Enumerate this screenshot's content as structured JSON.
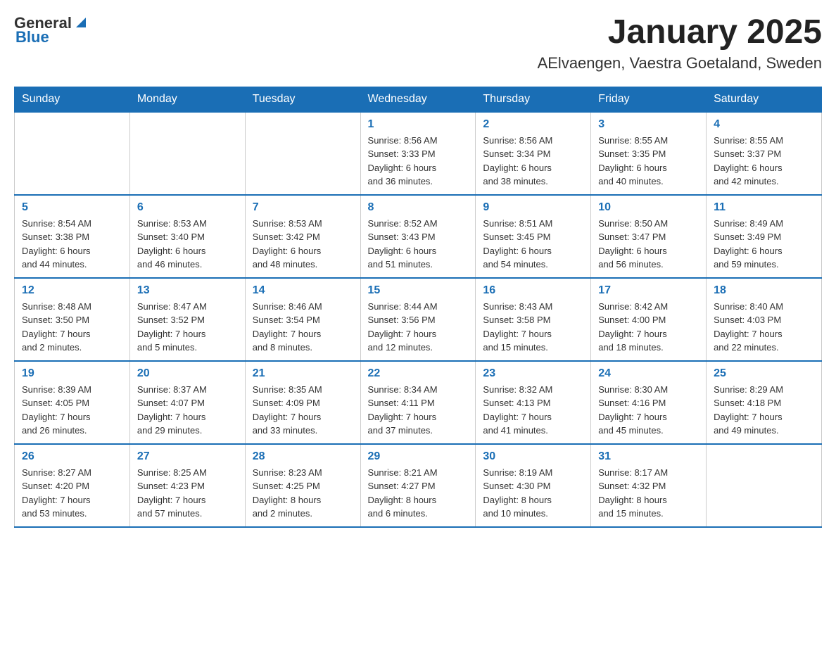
{
  "header": {
    "logo": {
      "general": "General",
      "blue": "Blue"
    },
    "title": "January 2025",
    "location": "AElvaengen, Vaestra Goetaland, Sweden"
  },
  "weekdays": [
    "Sunday",
    "Monday",
    "Tuesday",
    "Wednesday",
    "Thursday",
    "Friday",
    "Saturday"
  ],
  "weeks": [
    {
      "days": [
        {
          "number": "",
          "info": ""
        },
        {
          "number": "",
          "info": ""
        },
        {
          "number": "",
          "info": ""
        },
        {
          "number": "1",
          "info": "Sunrise: 8:56 AM\nSunset: 3:33 PM\nDaylight: 6 hours\nand 36 minutes."
        },
        {
          "number": "2",
          "info": "Sunrise: 8:56 AM\nSunset: 3:34 PM\nDaylight: 6 hours\nand 38 minutes."
        },
        {
          "number": "3",
          "info": "Sunrise: 8:55 AM\nSunset: 3:35 PM\nDaylight: 6 hours\nand 40 minutes."
        },
        {
          "number": "4",
          "info": "Sunrise: 8:55 AM\nSunset: 3:37 PM\nDaylight: 6 hours\nand 42 minutes."
        }
      ]
    },
    {
      "days": [
        {
          "number": "5",
          "info": "Sunrise: 8:54 AM\nSunset: 3:38 PM\nDaylight: 6 hours\nand 44 minutes."
        },
        {
          "number": "6",
          "info": "Sunrise: 8:53 AM\nSunset: 3:40 PM\nDaylight: 6 hours\nand 46 minutes."
        },
        {
          "number": "7",
          "info": "Sunrise: 8:53 AM\nSunset: 3:42 PM\nDaylight: 6 hours\nand 48 minutes."
        },
        {
          "number": "8",
          "info": "Sunrise: 8:52 AM\nSunset: 3:43 PM\nDaylight: 6 hours\nand 51 minutes."
        },
        {
          "number": "9",
          "info": "Sunrise: 8:51 AM\nSunset: 3:45 PM\nDaylight: 6 hours\nand 54 minutes."
        },
        {
          "number": "10",
          "info": "Sunrise: 8:50 AM\nSunset: 3:47 PM\nDaylight: 6 hours\nand 56 minutes."
        },
        {
          "number": "11",
          "info": "Sunrise: 8:49 AM\nSunset: 3:49 PM\nDaylight: 6 hours\nand 59 minutes."
        }
      ]
    },
    {
      "days": [
        {
          "number": "12",
          "info": "Sunrise: 8:48 AM\nSunset: 3:50 PM\nDaylight: 7 hours\nand 2 minutes."
        },
        {
          "number": "13",
          "info": "Sunrise: 8:47 AM\nSunset: 3:52 PM\nDaylight: 7 hours\nand 5 minutes."
        },
        {
          "number": "14",
          "info": "Sunrise: 8:46 AM\nSunset: 3:54 PM\nDaylight: 7 hours\nand 8 minutes."
        },
        {
          "number": "15",
          "info": "Sunrise: 8:44 AM\nSunset: 3:56 PM\nDaylight: 7 hours\nand 12 minutes."
        },
        {
          "number": "16",
          "info": "Sunrise: 8:43 AM\nSunset: 3:58 PM\nDaylight: 7 hours\nand 15 minutes."
        },
        {
          "number": "17",
          "info": "Sunrise: 8:42 AM\nSunset: 4:00 PM\nDaylight: 7 hours\nand 18 minutes."
        },
        {
          "number": "18",
          "info": "Sunrise: 8:40 AM\nSunset: 4:03 PM\nDaylight: 7 hours\nand 22 minutes."
        }
      ]
    },
    {
      "days": [
        {
          "number": "19",
          "info": "Sunrise: 8:39 AM\nSunset: 4:05 PM\nDaylight: 7 hours\nand 26 minutes."
        },
        {
          "number": "20",
          "info": "Sunrise: 8:37 AM\nSunset: 4:07 PM\nDaylight: 7 hours\nand 29 minutes."
        },
        {
          "number": "21",
          "info": "Sunrise: 8:35 AM\nSunset: 4:09 PM\nDaylight: 7 hours\nand 33 minutes."
        },
        {
          "number": "22",
          "info": "Sunrise: 8:34 AM\nSunset: 4:11 PM\nDaylight: 7 hours\nand 37 minutes."
        },
        {
          "number": "23",
          "info": "Sunrise: 8:32 AM\nSunset: 4:13 PM\nDaylight: 7 hours\nand 41 minutes."
        },
        {
          "number": "24",
          "info": "Sunrise: 8:30 AM\nSunset: 4:16 PM\nDaylight: 7 hours\nand 45 minutes."
        },
        {
          "number": "25",
          "info": "Sunrise: 8:29 AM\nSunset: 4:18 PM\nDaylight: 7 hours\nand 49 minutes."
        }
      ]
    },
    {
      "days": [
        {
          "number": "26",
          "info": "Sunrise: 8:27 AM\nSunset: 4:20 PM\nDaylight: 7 hours\nand 53 minutes."
        },
        {
          "number": "27",
          "info": "Sunrise: 8:25 AM\nSunset: 4:23 PM\nDaylight: 7 hours\nand 57 minutes."
        },
        {
          "number": "28",
          "info": "Sunrise: 8:23 AM\nSunset: 4:25 PM\nDaylight: 8 hours\nand 2 minutes."
        },
        {
          "number": "29",
          "info": "Sunrise: 8:21 AM\nSunset: 4:27 PM\nDaylight: 8 hours\nand 6 minutes."
        },
        {
          "number": "30",
          "info": "Sunrise: 8:19 AM\nSunset: 4:30 PM\nDaylight: 8 hours\nand 10 minutes."
        },
        {
          "number": "31",
          "info": "Sunrise: 8:17 AM\nSunset: 4:32 PM\nDaylight: 8 hours\nand 15 minutes."
        },
        {
          "number": "",
          "info": ""
        }
      ]
    }
  ]
}
